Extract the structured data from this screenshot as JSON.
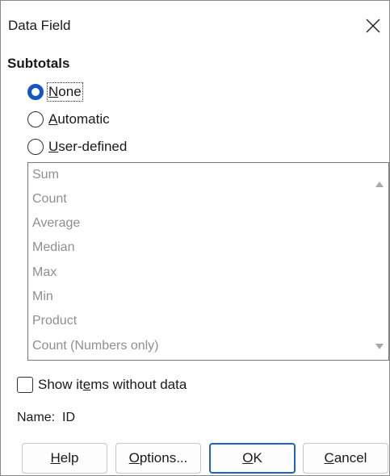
{
  "dialog": {
    "title": "Data Field",
    "close_glyph": "X"
  },
  "subtotals": {
    "heading": "Subtotals",
    "options": [
      {
        "pre": "",
        "key": "N",
        "post": "one",
        "selected": true
      },
      {
        "pre": "",
        "key": "A",
        "post": "utomatic",
        "selected": false
      },
      {
        "pre": "",
        "key": "U",
        "post": "ser-defined",
        "selected": false
      }
    ],
    "functions": [
      "Sum",
      "Count",
      "Average",
      "Median",
      "Max",
      "Min",
      "Product",
      "Count (Numbers only)"
    ]
  },
  "show_items": {
    "pre": "Show it",
    "key": "e",
    "post": "ms without data",
    "checked": false
  },
  "name": {
    "label": "Name:",
    "value": "ID"
  },
  "buttons": {
    "help": {
      "pre": "",
      "key": "H",
      "post": "elp"
    },
    "options": {
      "pre": "",
      "key": "O",
      "post": "ptions..."
    },
    "ok": {
      "pre": "",
      "key": "O",
      "post": "K"
    },
    "cancel": {
      "pre": "",
      "key": "C",
      "post": "ancel"
    }
  },
  "colors": {
    "accent": "#1656c2",
    "disabled_text": "#8f8f8f",
    "border": "#7a7a7a"
  }
}
